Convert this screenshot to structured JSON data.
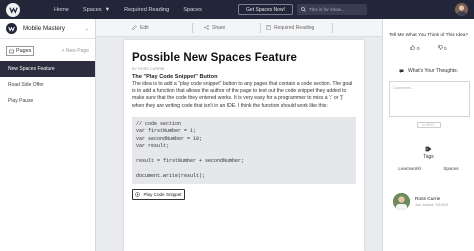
{
  "topbar": {
    "nav": [
      "Home",
      "Spaces",
      "Required Reading",
      "Spaces"
    ],
    "get_spaces_button": "Get Spaces Now!",
    "search_placeholder": "This is for show...",
    "colors": {
      "bg": "#232538"
    }
  },
  "sidebar": {
    "space_name": "Mobile Mastery",
    "pages_label": "Pages",
    "new_page_label": "+ New Page",
    "pages": [
      {
        "label": "New Spaces Feature",
        "active": true
      },
      {
        "label": "Road Side Offer",
        "active": false
      },
      {
        "label": "Play Pause",
        "active": false
      }
    ]
  },
  "toolbar": {
    "edit_label": "Edit",
    "share_label": "Share",
    "required_reading_label": "Required Reading"
  },
  "doc": {
    "title": "Possible New Spaces Feature",
    "byline": "BY ROSS CURRIE",
    "subtitle": "The \"Play Code Snippet\" Button",
    "body": "The idea is to add a \"play code snippet\" button to any pages that contain a code section. The goal is to add a function that allows the author of the page to test out the code snippet they added to make sure that the code they entered works. It is very easy for a programmer to miss a ';' or '}' when they are writing code that isn't in an IDE. I think the function should work like this:",
    "code_lines": [
      "// code section",
      "var firstNumber = 1;",
      "var secondNumber = 10;",
      "var result;",
      "",
      "result = firstNumber + secondNumber;",
      "",
      "document.write(result);"
    ],
    "play_button": "Play Code Snippet"
  },
  "right_panel": {
    "question": "Tell Me What You Think of This Idea?",
    "upvotes": "0",
    "downvotes": "0",
    "thoughts_label": "What's Your Thoughts:",
    "comment_placeholder": "Comment...",
    "submit_label": "SUBMIT",
    "tags_label": "Tags",
    "tags": [
      "Learnworkl",
      "Spaces"
    ],
    "author_name": "Ross Currie",
    "author_meta": "Joe Joined: 3/10/20"
  }
}
